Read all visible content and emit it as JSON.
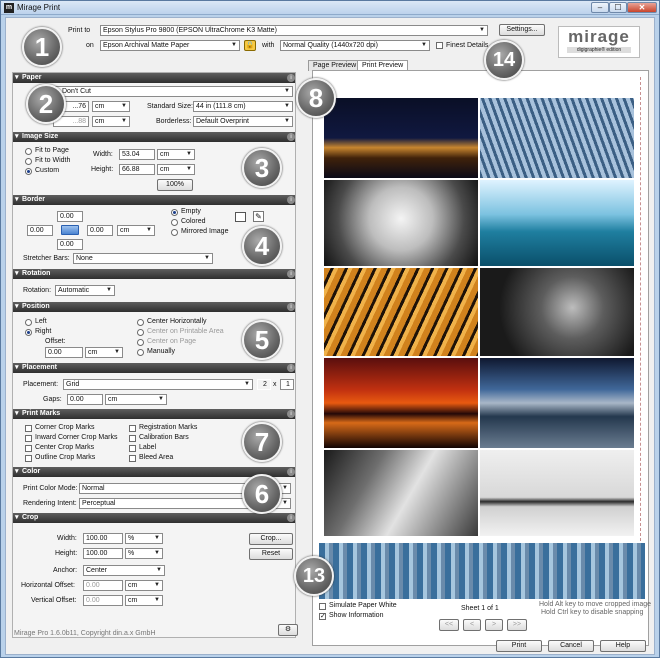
{
  "window": {
    "title": "Mirage Print",
    "min": "–",
    "max": "☐",
    "close": "✕"
  },
  "top": {
    "print_to_label": "Print to",
    "printer": "Epson Stylus Pro 9800 (EPSON UltraChrome K3 Matte)",
    "on_label": "on",
    "paper": "Epson Archival Matte Paper",
    "with_label": "with",
    "quality": "Normal Quality (1440x720 dpi)",
    "finest_details": "Finest Details",
    "settings": "Settings...",
    "logo_main": "mirage",
    "logo_sub": "digigraphie® edition"
  },
  "badges": [
    "1",
    "2",
    "3",
    "4",
    "5",
    "6",
    "7",
    "8",
    "13",
    "14"
  ],
  "paper": {
    "title": "Paper",
    "roll": "...t - Don't Cut",
    "width": "...76",
    "unit": "cm",
    "height": "...88",
    "unit2": "cm",
    "std_size_label": "Standard Size:",
    "std_size": "44 in (111.8 cm)",
    "borderless_label": "Borderless:",
    "borderless": "Default Overprint"
  },
  "image_size": {
    "title": "Image Size",
    "fit_page": "Fit to Page",
    "fit_width": "Fit to Width",
    "custom": "Custom",
    "width_label": "Width:",
    "width": "53.04",
    "height_label": "Height:",
    "height": "66.88",
    "unit": "cm",
    "unit2": "cm",
    "pct": "100%"
  },
  "border": {
    "title": "Border",
    "top": "0.00",
    "left": "0.00",
    "right": "0.00",
    "bottom": "0.00",
    "unit": "cm",
    "empty": "Empty",
    "colored": "Colored",
    "mirrored": "Mirrored Image",
    "stretcher_label": "Stretcher Bars:",
    "stretcher": "None"
  },
  "rotation": {
    "title": "Rotation",
    "label": "Rotation:",
    "value": "Automatic"
  },
  "position": {
    "title": "Position",
    "left": "Left",
    "right": "Right",
    "offset_label": "Offset:",
    "offset": "0.00",
    "unit": "cm",
    "center_h": "Center Horizontally",
    "center_print": "Center on Printable Area",
    "center_page": "Center on Page",
    "manually": "Manually"
  },
  "placement": {
    "title": "Placement",
    "label": "Placement:",
    "value": "Grid",
    "cols": "2",
    "x": "x",
    "rows": "1",
    "gaps_label": "Gaps:",
    "gaps": "0.00",
    "unit": "cm"
  },
  "print_marks": {
    "title": "Print Marks",
    "corner": "Corner Crop Marks",
    "inward": "Inward Corner Crop Marks",
    "center": "Center Crop Marks",
    "outline": "Outline Crop Marks",
    "registration": "Registration Marks",
    "calibration": "Calibration Bars",
    "label": "Label",
    "bleed": "Bleed Area"
  },
  "color": {
    "title": "Color",
    "mode_label": "Print Color Mode:",
    "mode": "Normal",
    "intent_label": "Rendering Intent:",
    "intent": "Perceptual"
  },
  "crop": {
    "title": "Crop",
    "width_label": "Width:",
    "width": "100.00",
    "height_label": "Height:",
    "height": "100.00",
    "pct": "%",
    "pct2": "%",
    "crop_btn": "Crop...",
    "reset": "Reset",
    "anchor_label": "Anchor:",
    "anchor": "Center",
    "hoff_label": "Horizontal Offset:",
    "hoff": "0.00",
    "voff_label": "Vertical Offset:",
    "voff": "0.00",
    "unit": "cm",
    "unit2": "cm"
  },
  "footer": {
    "copyright": "Mirage Pro 1.6.0b11, Copyright din.a.x GmbH",
    "gear": "⚙"
  },
  "preview": {
    "tab_page": "Page Preview",
    "tab_print": "Print Preview",
    "simulate": "Simulate Paper White",
    "show_info": "Show Information",
    "sheet": "Sheet 1 of 1",
    "hint1": "Hold Alt key to move cropped image",
    "hint2": "Hold Ctrl key to disable snapping",
    "nav": [
      "<<",
      "<",
      ">",
      ">>"
    ]
  },
  "actions": {
    "print": "Print",
    "cancel": "Cancel",
    "help": "Help"
  },
  "colors": {
    "section": "#3a3a3a",
    "accent": "#1b3e8a",
    "badge": "#6a6a6a"
  }
}
